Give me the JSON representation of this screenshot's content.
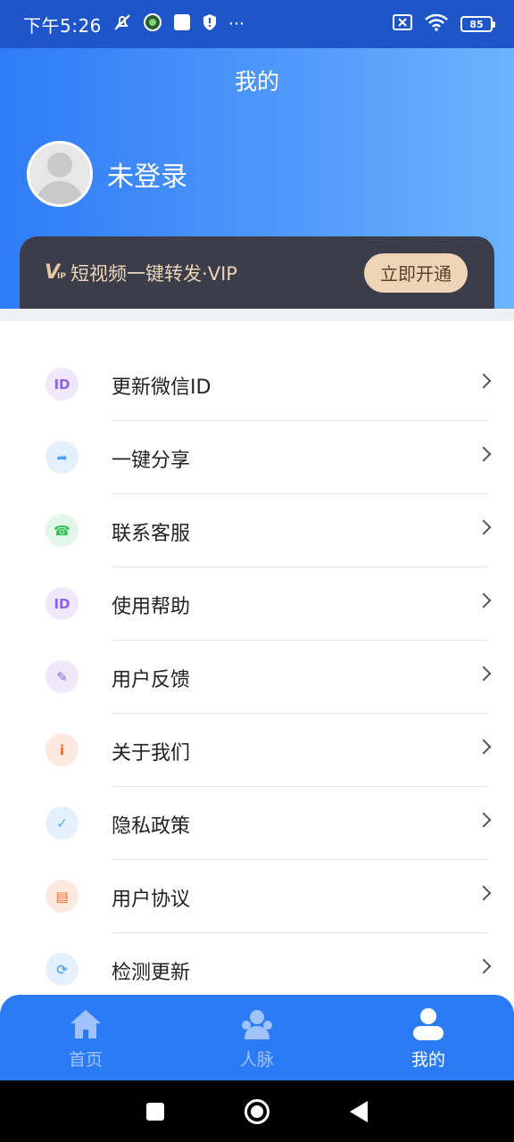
{
  "status_bar": {
    "time": "下午5:26",
    "extra": "···",
    "battery": "85"
  },
  "header": {
    "title": "我的"
  },
  "user": {
    "name": "未登录"
  },
  "vip": {
    "logo": "V",
    "logo_sub": "IP",
    "text": "短视频一键转发·VIP",
    "button": "立即开通"
  },
  "menu": [
    {
      "label": "更新微信ID",
      "icon": "id-icon",
      "icon_text": "ID",
      "color": "#8a63e8",
      "bg": "#efe8fb"
    },
    {
      "label": "一键分享",
      "icon": "share-icon",
      "icon_text": "➦",
      "color": "#4aa3f5",
      "bg": "#e4f1fd"
    },
    {
      "label": "联系客服",
      "icon": "headset-icon",
      "icon_text": "☎",
      "color": "#33c25a",
      "bg": "#e3f7e8"
    },
    {
      "label": "使用帮助",
      "icon": "id-icon",
      "icon_text": "ID",
      "color": "#8a63e8",
      "bg": "#efe8fb"
    },
    {
      "label": "用户反馈",
      "icon": "feedback-icon",
      "icon_text": "✎",
      "color": "#8a63e8",
      "bg": "#efe8fb"
    },
    {
      "label": "关于我们",
      "icon": "info-icon",
      "icon_text": "i",
      "color": "#ef6b2c",
      "bg": "#fde9df"
    },
    {
      "label": "隐私政策",
      "icon": "shield-icon",
      "icon_text": "✓",
      "color": "#5aa9f0",
      "bg": "#e4f1fd"
    },
    {
      "label": "用户协议",
      "icon": "book-icon",
      "icon_text": "▤",
      "color": "#ef6b2c",
      "bg": "#fde9df"
    },
    {
      "label": "检测更新",
      "icon": "refresh-icon",
      "icon_text": "⟳",
      "color": "#5aa9f0",
      "bg": "#e4f1fd"
    }
  ],
  "tabs": [
    {
      "label": "首页",
      "icon": "home-icon",
      "active": false
    },
    {
      "label": "人脉",
      "icon": "contacts-icon",
      "active": false
    },
    {
      "label": "我的",
      "icon": "profile-icon",
      "active": true
    }
  ]
}
